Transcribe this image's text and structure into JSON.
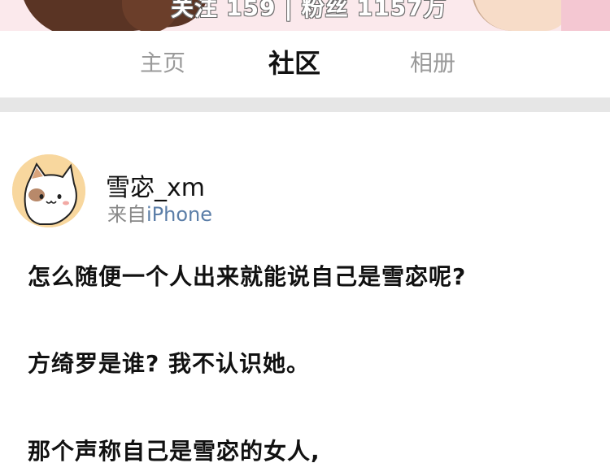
{
  "profile": {
    "follow_label": "关注",
    "follow_count": "159",
    "separator": "|",
    "fans_label": "粉丝",
    "fans_count": "1157万"
  },
  "tabs": [
    {
      "label": "主页",
      "active": false
    },
    {
      "label": "社区",
      "active": true
    },
    {
      "label": "相册",
      "active": false
    }
  ],
  "post": {
    "author": "雪宓_xm",
    "source_prefix": "来自",
    "source_device": "iPhone",
    "avatar_icon": "cat-avatar-icon",
    "lines": [
      "怎么随便一个人出来就能说自己是雪宓呢?",
      "方绮罗是谁? 我不认识她。",
      "那个声称自己是雪宓的女人,"
    ]
  },
  "colors": {
    "active_tab": "#111111",
    "inactive_tab": "#9a9a9a",
    "divider": "#e6e6e6",
    "avatar_bg": "#f8d79e",
    "source_text": "#888888"
  }
}
